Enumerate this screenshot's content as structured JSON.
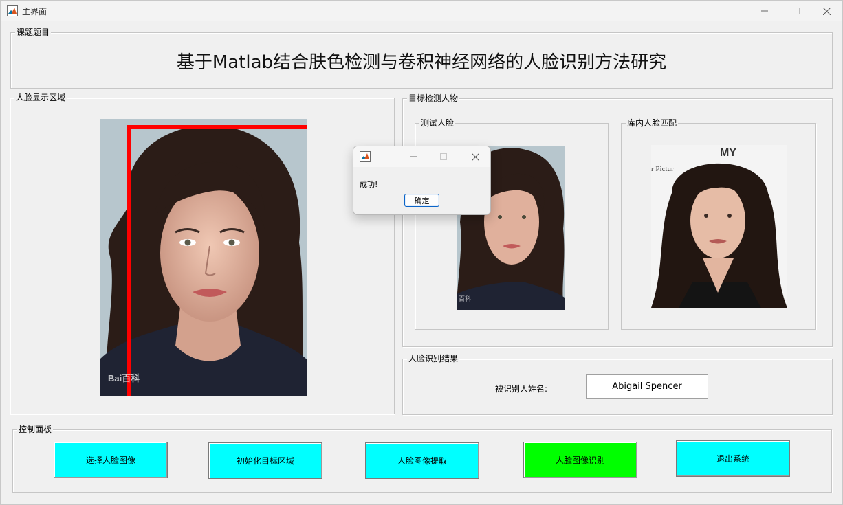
{
  "window": {
    "title": "主界面",
    "minimize_glyph": "minimize-icon",
    "maximize_glyph": "maximize-icon",
    "close_glyph": "close-icon"
  },
  "topic_panel": {
    "legend": "课题题目",
    "title": "基于Matlab结合肤色检测与卷积神经网络的人脸识别方法研究"
  },
  "face_display_panel": {
    "legend": "人脸显示区域",
    "watermark": "Bai百科"
  },
  "target_panel": {
    "legend": "目标检测人物",
    "test_face_legend": "测试人脸",
    "library_match_legend": "库内人脸匹配",
    "library_watermark": "r Pictur"
  },
  "result_panel": {
    "legend": "人脸识别结果",
    "name_label": "被识别人姓名:",
    "name_value": "Abigail Spencer"
  },
  "control_panel": {
    "legend": "控制面板",
    "buttons": [
      {
        "label": "选择人脸图像",
        "color": "#00ffff"
      },
      {
        "label": "初始化目标区域",
        "color": "#00ffff"
      },
      {
        "label": "人脸图像提取",
        "color": "#00ffff"
      },
      {
        "label": "人脸图像识别",
        "color": "#00ff00"
      },
      {
        "label": "退出系统",
        "color": "#00ffff"
      }
    ]
  },
  "dialog": {
    "message": "成功!",
    "ok_label": "确定"
  },
  "colors": {
    "window_bg": "#f0f0f0",
    "detect_box": "#ff0000",
    "button_cyan": "#00ffff",
    "button_green": "#00ff00"
  }
}
